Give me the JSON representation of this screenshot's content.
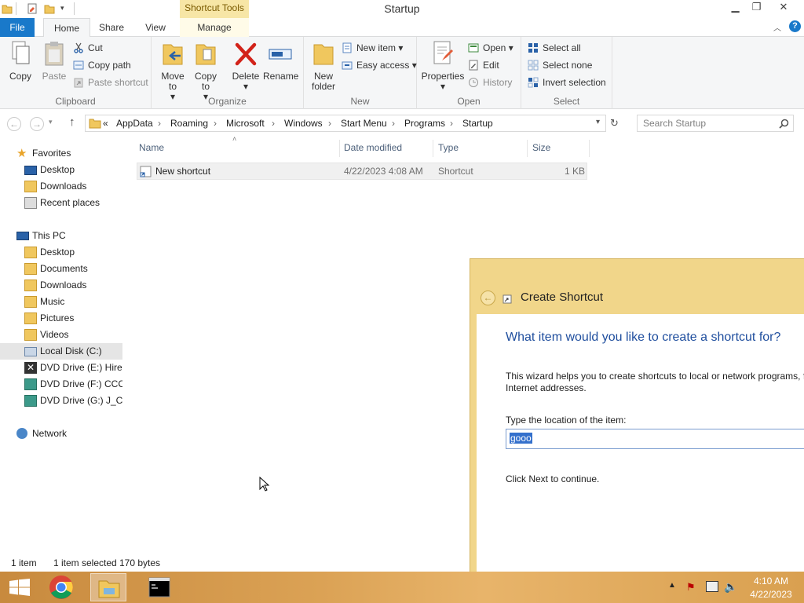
{
  "window": {
    "title": "Startup",
    "contextual_tab": "Shortcut Tools"
  },
  "tabs": {
    "file": "File",
    "home": "Home",
    "share": "Share",
    "view": "View",
    "manage": "Manage"
  },
  "ribbon": {
    "clipboard": {
      "label": "Clipboard",
      "copy": "Copy",
      "paste": "Paste",
      "cut": "Cut",
      "copy_path": "Copy path",
      "paste_shortcut": "Paste shortcut"
    },
    "organize": {
      "label": "Organize",
      "move_to": [
        "Move",
        "to"
      ],
      "copy_to": [
        "Copy",
        "to"
      ],
      "delete": "Delete",
      "rename": "Rename"
    },
    "new": {
      "label": "New",
      "new_folder": [
        "New",
        "folder"
      ],
      "new_item": "New item",
      "easy_access": "Easy access"
    },
    "open": {
      "label": "Open",
      "properties": "Properties",
      "open": "Open",
      "edit": "Edit",
      "history": "History"
    },
    "select": {
      "label": "Select",
      "select_all": "Select all",
      "select_none": "Select none",
      "invert_selection": "Invert selection"
    }
  },
  "address": {
    "prefix": "«",
    "crumbs": [
      "AppData",
      "Roaming",
      "Microsoft",
      "Windows",
      "Start Menu",
      "Programs",
      "Startup"
    ],
    "search_placeholder": "Search Startup"
  },
  "nav": {
    "favorites": "Favorites",
    "fav_items": [
      "Desktop",
      "Downloads",
      "Recent places"
    ],
    "this_pc": "This PC",
    "pc_items": [
      "Desktop",
      "Documents",
      "Downloads",
      "Music",
      "Pictures",
      "Videos",
      "Local Disk (C:)",
      "DVD Drive (E:) Hiren",
      "DVD Drive (F:) CCCC",
      "DVD Drive (G:) J_CEN"
    ],
    "network": "Network"
  },
  "filelist": {
    "columns": [
      "Name",
      "Date modified",
      "Type",
      "Size"
    ],
    "rows": [
      {
        "name": "New shortcut",
        "date": "4/22/2023 4:08 AM",
        "type": "Shortcut",
        "size": "1 KB"
      }
    ]
  },
  "status": {
    "count": "1 item",
    "selected": "1 item selected",
    "size": "170 bytes"
  },
  "dialog": {
    "title": "Create Shortcut",
    "heading": "What item would you like to create a shortcut for?",
    "description_line1": "This wizard helps you to create shortcuts to local or network programs, f",
    "description_line2": "Internet addresses.",
    "location_label": "Type the location of the item:",
    "location_value": "gooo",
    "footer": "Click Next to continue."
  },
  "taskbar": {
    "time": "4:10 AM",
    "date": "4/22/2023"
  },
  "colors": {
    "accent": "#1979ca",
    "folder": "#f0c75e",
    "dialog_frame": "#f1d68a",
    "heading": "#1f4e9e"
  }
}
